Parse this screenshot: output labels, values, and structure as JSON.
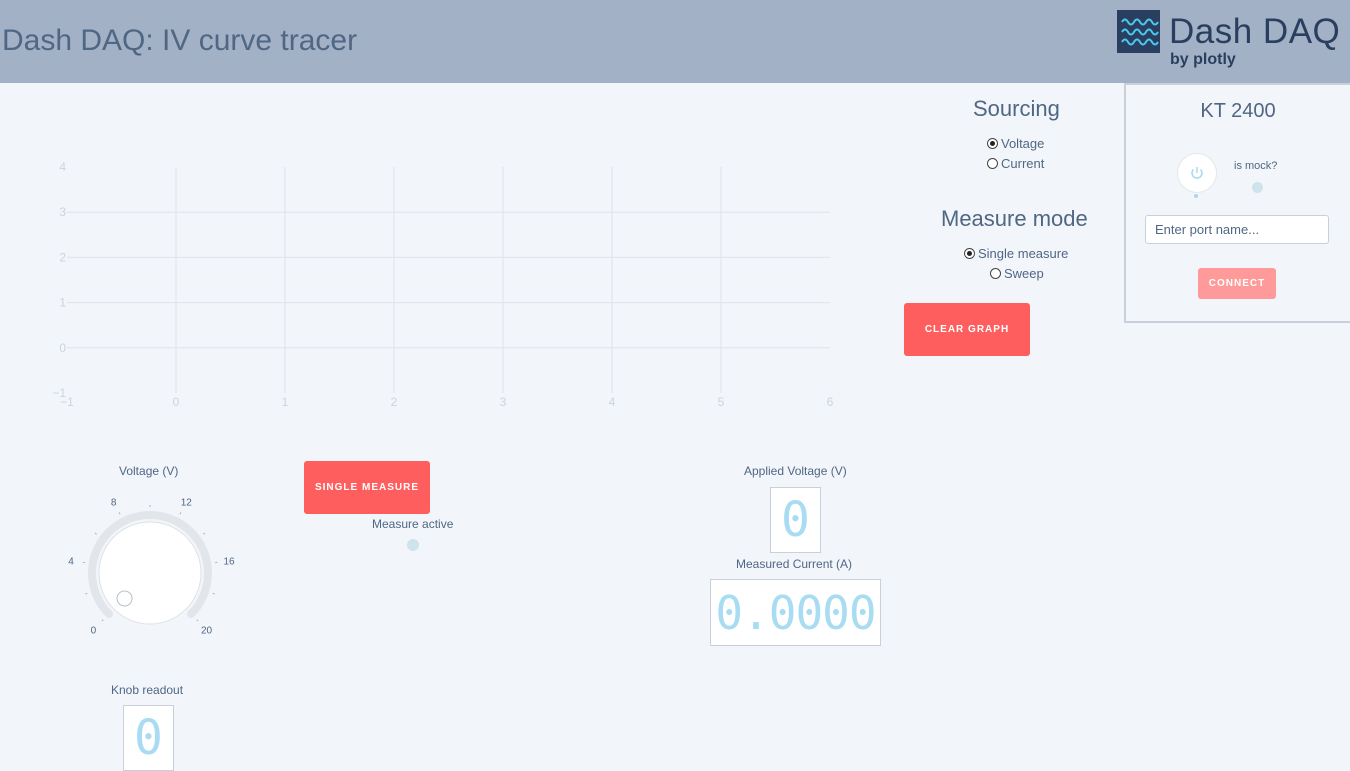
{
  "header": {
    "title": "Dash DAQ: IV curve tracer"
  },
  "logo": {
    "name": "Dash DAQ",
    "byline": "by plotly",
    "icon": "waveform-icon"
  },
  "chart_data": {
    "type": "line",
    "series": [],
    "xlim": [
      -1,
      6
    ],
    "ylim": [
      -1,
      4
    ],
    "x_ticks": [
      "−1",
      "0",
      "1",
      "2",
      "3",
      "4",
      "5",
      "6"
    ],
    "y_ticks": [
      "4",
      "3",
      "2",
      "1",
      "0",
      "−1"
    ],
    "grid": true
  },
  "sourcing": {
    "title": "Sourcing",
    "options": [
      "Voltage",
      "Current"
    ],
    "selected": "Voltage"
  },
  "measure_mode": {
    "title": "Measure mode",
    "options": [
      "Single measure",
      "Sweep"
    ],
    "selected": "Single measure"
  },
  "buttons": {
    "clear_graph": "CLEAR GRAPH",
    "single_measure": "SINGLE MEASURE",
    "connect": "CONNECT"
  },
  "instrument": {
    "title": "KT 2400",
    "mock_label": "is mock?",
    "port_placeholder": "Enter port name...",
    "power_icon": "power-icon"
  },
  "knob": {
    "label": "Voltage (V)",
    "scale_labels": [
      "0",
      "4",
      "8",
      "12",
      "16",
      "20"
    ],
    "value": 0,
    "min": 0,
    "max": 20
  },
  "measure_active_label": "Measure active",
  "applied_voltage": {
    "label": "Applied Voltage (V)",
    "value": "0"
  },
  "measured_current": {
    "label": "Measured Current (A)",
    "value": "0.0000"
  },
  "knob_readout": {
    "label": "Knob readout",
    "value": "0"
  },
  "colors": {
    "banner": "#a2b1c6",
    "accent": "#ff5e5e",
    "display_digits": "#a7dcf2",
    "background": "#f2f5fa"
  }
}
